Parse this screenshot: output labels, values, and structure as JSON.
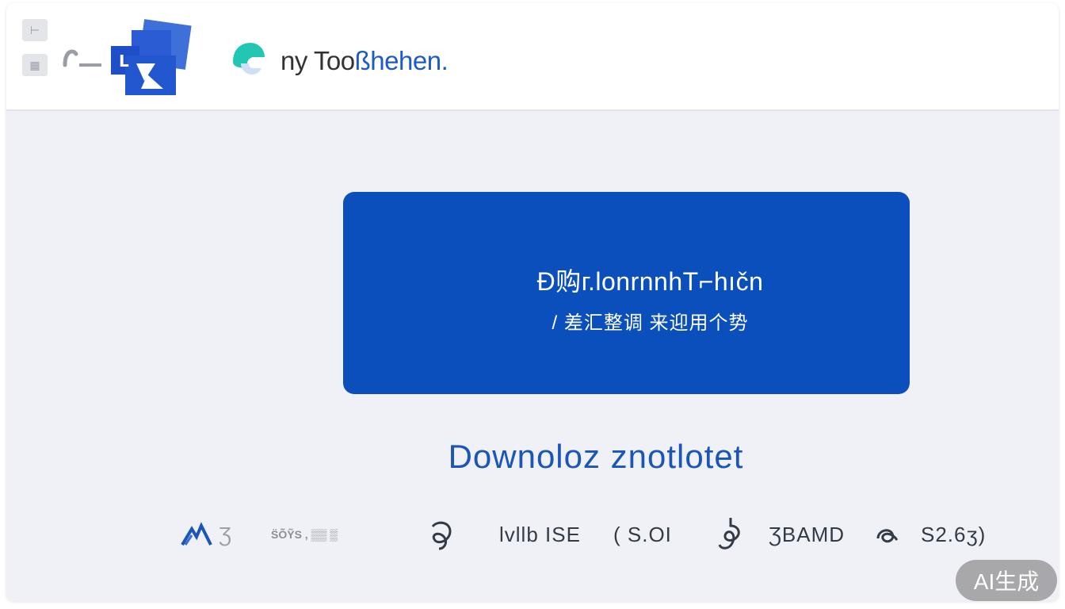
{
  "header": {
    "tool_buttons": [
      "⊢",
      "▦"
    ],
    "brand": {
      "prefix": "ny Too",
      "accent": "ßhehen."
    }
  },
  "promo": {
    "title": "Đ购г.lonrnnhT⌐hıčn",
    "subtitle": "/ 差汇整调  来迎用个势"
  },
  "download": {
    "label": "Downoloz znotlotet"
  },
  "partners": [
    {
      "kind": "logo",
      "name": "mountain-logo-icon",
      "text": "Ʒ"
    },
    {
      "kind": "text-small",
      "text": "S̈Õ̃ỸS , ▒▒ ▒"
    },
    {
      "kind": "logo",
      "name": "swirl-logo-icon",
      "text": ""
    },
    {
      "kind": "text",
      "text": "lvllb ISE"
    },
    {
      "kind": "text",
      "text": "( S.OI"
    },
    {
      "kind": "logo",
      "name": "knot-logo-icon",
      "text": ""
    },
    {
      "kind": "text",
      "text": "ƷBAMD"
    },
    {
      "kind": "text",
      "text": "S2.6ӡ)"
    }
  ],
  "ai_badge": "AI生成",
  "colors": {
    "primary": "#0a4fbc",
    "accent": "#1f5bc4",
    "teal": "#21c7b0",
    "background": "#eff1f6"
  }
}
